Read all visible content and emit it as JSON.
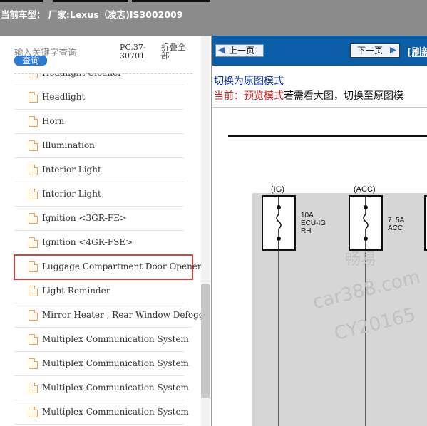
{
  "header": {
    "title": "当前车型： 厂家:Lexus（凌志)IS3002009"
  },
  "search": {
    "placeholder": "输入关键字查询",
    "button_label": "查询",
    "pc_code": "PC.37-30701",
    "collapse_label": "折叠全部"
  },
  "tree": {
    "items": [
      {
        "label": "Headlight Cleaner"
      },
      {
        "label": "Headlight"
      },
      {
        "label": "Horn"
      },
      {
        "label": "Illumination"
      },
      {
        "label": "Interior Light"
      },
      {
        "label": "Interior Light"
      },
      {
        "label": "Ignition <3GR-FE>"
      },
      {
        "label": "Ignition <4GR-FSE>"
      },
      {
        "label": "Luggage Compartment Door Opener"
      },
      {
        "label": "Light Reminder"
      },
      {
        "label": "Mirror Heater , Rear Window Defogger"
      },
      {
        "label": "Multiplex Communication System"
      },
      {
        "label": "Multiplex Communication System"
      },
      {
        "label": "Multiplex Communication System"
      },
      {
        "label": "Multiplex Communication System"
      }
    ]
  },
  "viewer": {
    "prev_label": "上一页",
    "next_label": "下一页",
    "refresh_label": "[刷新",
    "switch_link": "切换为原图模式",
    "mode_current": "当前：预览模式",
    "mode_hint": "若需看大图，切换至原图模"
  },
  "diagram": {
    "fuse1_label": "(IG)",
    "fuse1_amp": "10A",
    "fuse1_name": "ECU-IG",
    "fuse1_side": "RH",
    "fuse2_label": "(ACC)",
    "fuse2_amp": "7. 5A",
    "fuse2_name": "ACC",
    "watermark1": "畅易",
    "watermark2": "car388.com",
    "watermark3": "CY20165"
  },
  "colors": {
    "nav_blue": "#0a5ea8",
    "highlight_red": "#d94040",
    "link_blue": "#0a2aa0",
    "mode_red": "#d01c1c"
  }
}
